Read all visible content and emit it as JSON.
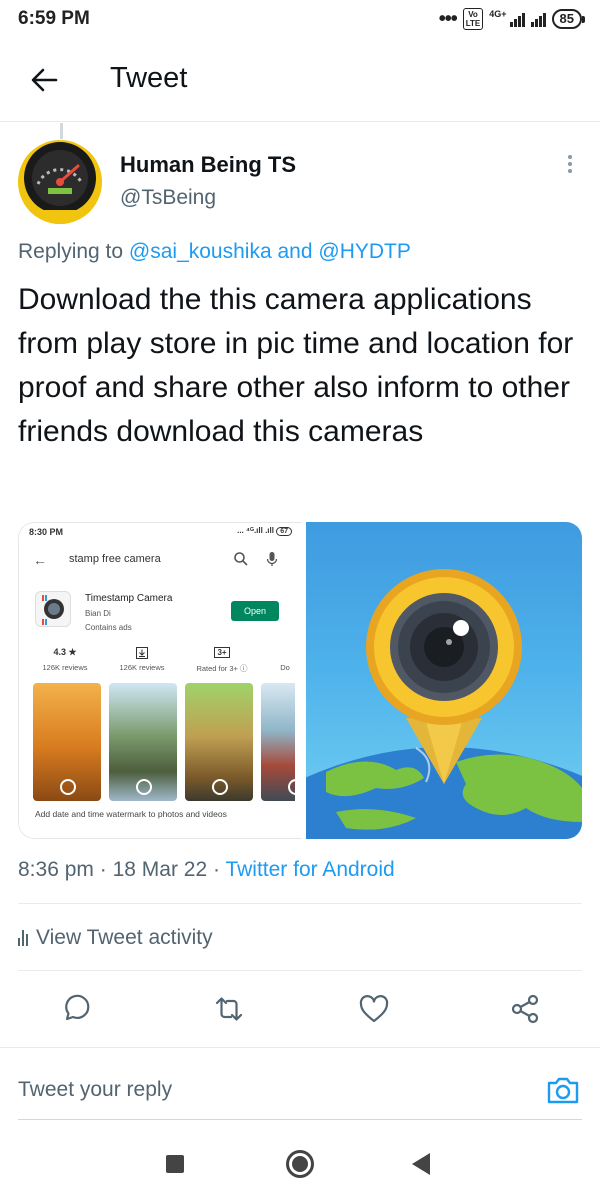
{
  "status_bar": {
    "time": "6:59 PM",
    "volte": "Vo LTE",
    "network": "4G+",
    "battery": "85"
  },
  "header": {
    "back_icon": "arrow-left-icon",
    "title": "Tweet"
  },
  "tweet": {
    "author_name": "Human Being TS",
    "author_handle": "@TsBeing",
    "replying_prefix": "Replying to",
    "replying_user_1": "@sai_koushika",
    "replying_joiner": "and",
    "replying_user_2": "@HYDTP",
    "text": "Download the this camera applications from play store in pic time and location for proof and share other also inform to other friends download this cameras",
    "time": "8:36 pm",
    "sep": "·",
    "date": "18 Mar 22",
    "source": "Twitter for Android",
    "view_activity": "View Tweet activity"
  },
  "screenshot_in_media": {
    "time": "8:30 PM",
    "sys": "...  ⁴ᴳ.ıll .ıll",
    "battery": "67",
    "query": "stamp free camera",
    "app_name": "Timestamp Camera",
    "developer": "Bian Di",
    "contains_ads": "Contains ads",
    "open_label": "Open",
    "rating": "4.3 ★",
    "rating_label": "126K reviews",
    "reviews_label": "126K reviews",
    "age_value": "3+",
    "age_label": "Rated for 3+ ⓘ",
    "extra_label": "Do",
    "caption": "Add date and time watermark to photos and videos"
  },
  "reply": {
    "placeholder": "Tweet your reply"
  },
  "colors": {
    "accent": "#1d9bf0",
    "secondary_text": "#536471",
    "playstore_green": "#01875f"
  }
}
